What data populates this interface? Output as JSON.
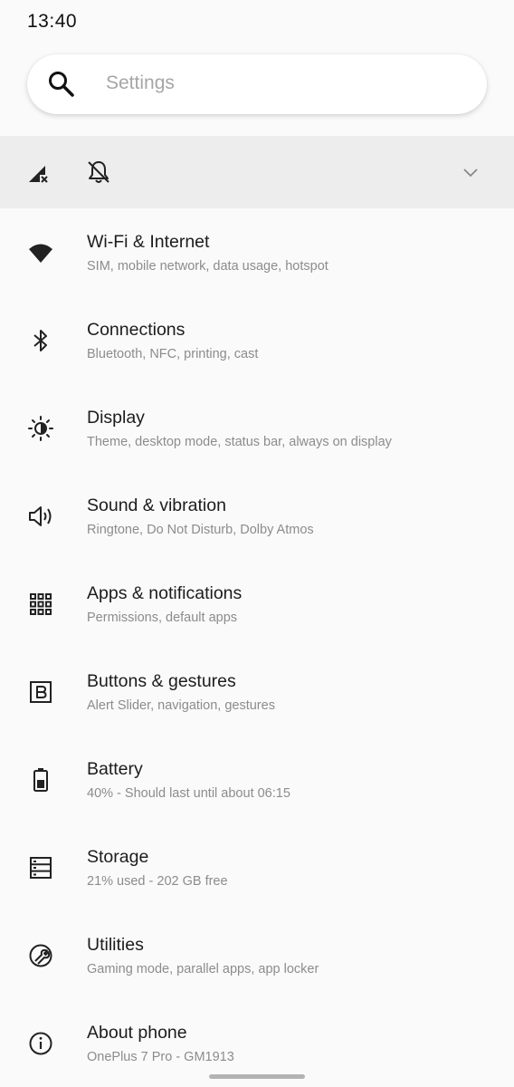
{
  "status_bar": {
    "time": "13:40"
  },
  "search": {
    "placeholder": "Settings",
    "icon": "search-icon"
  },
  "quick_row": {
    "icons": [
      "no-signal-icon",
      "bell-off-icon",
      "chevron-down-icon"
    ]
  },
  "items": [
    {
      "title": "Wi-Fi & Internet",
      "subtitle": "SIM, mobile network, data usage, hotspot",
      "icon": "wifi-icon"
    },
    {
      "title": "Connections",
      "subtitle": "Bluetooth, NFC, printing, cast",
      "icon": "bluetooth-icon"
    },
    {
      "title": "Display",
      "subtitle": "Theme, desktop mode, status bar, always on display",
      "icon": "brightness-icon"
    },
    {
      "title": "Sound & vibration",
      "subtitle": "Ringtone, Do Not Disturb, Dolby Atmos",
      "icon": "speaker-icon"
    },
    {
      "title": "Apps & notifications",
      "subtitle": "Permissions, default apps",
      "icon": "apps-grid-icon"
    },
    {
      "title": "Buttons & gestures",
      "subtitle": "Alert Slider, navigation, gestures",
      "icon": "button-b-icon"
    },
    {
      "title": "Battery",
      "subtitle": "40% - Should last until about 06:15",
      "icon": "battery-icon"
    },
    {
      "title": "Storage",
      "subtitle": "21% used - 202 GB free",
      "icon": "storage-icon"
    },
    {
      "title": "Utilities",
      "subtitle": "Gaming mode, parallel apps, app locker",
      "icon": "wrench-icon"
    },
    {
      "title": "About phone",
      "subtitle": "OnePlus 7 Pro - GM1913",
      "icon": "info-icon"
    }
  ]
}
